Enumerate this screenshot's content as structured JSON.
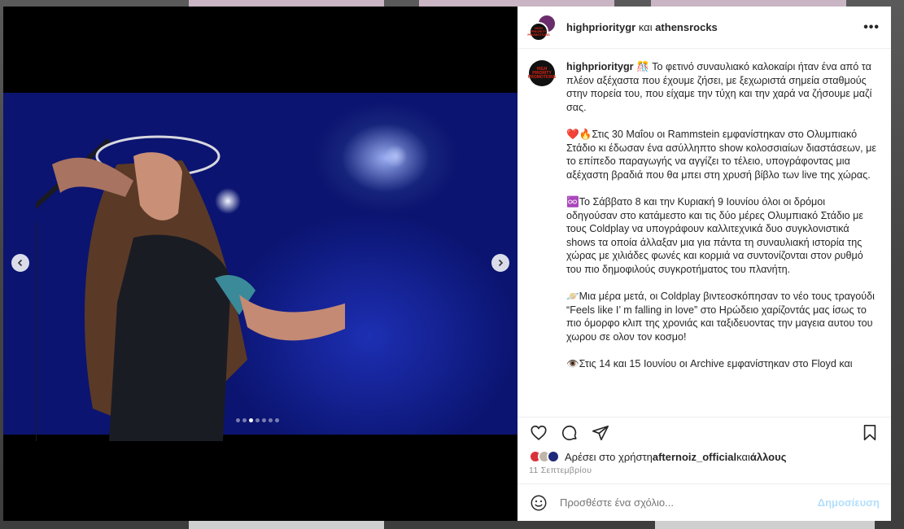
{
  "header": {
    "user1": "highprioritygr",
    "connector": " και ",
    "user2": "athensrocks"
  },
  "caption": {
    "username": "highprioritygr",
    "paragraphs": [
      "🎊 Το φετινό συναυλιακό καλοκαίρι ήταν ένα από τα πλέον αξέχαστα που έχουμε ζήσει, με ξεχωριστά σημεία σταθμούς στην πορεία του, που είχαμε την τύχη και την χαρά να ζήσουμε μαζί σας.",
      "❤️🔥Στις 30 Μαΐου οι Rammstein εμφανίστηκαν στο Ολυμπιακό Στάδιο κι έδωσαν ένα ασύλληπτο show κολοσσιαίων διαστάσεων, με το επίπεδο παραγωγής να αγγίζει το τέλειο, υπογράφοντας μια αξέχαστη βραδιά που θα μπει στη χρυσή βίβλο των live της χώρας.",
      "♾️Το Σάββατο 8 και την Κυριακή 9 Ιουνίου όλοι οι δρόμοι οδηγούσαν στο κατάμεστο και τις δύο μέρες Ολυμπιακό Στάδιο με τους Coldplay να υπογράφουν καλλιτεχνικά δυο συγκλονιστικά shows τα οποία άλλαξαν μια για πάντα τη συναυλιακή ιστορία της χώρας με χιλιάδες φωνές και κορμιά να συντονίζονται στον ρυθμό του πιο δημοφιλούς συγκροτήματος του πλανήτη.",
      "🪐Μια μέρα μετά, οι Coldplay βιντεοσκόπησαν το νέο τους τραγούδι “Feels like I’ m falling in love” στο Ηρώδειο χαρίζοντάς μας ίσως το πιο όμορφο κλιπ της χρονιάς και ταξιδευοντας την μαγεια αυτου του χωρου σε ολον τον κοσμο!",
      "👁️Στις 14 και 15 Ιουνίου οι Archive εμφανίστηκαν στο Floyd και"
    ]
  },
  "likes": {
    "prefix": "Αρέσει στο χρήστη ",
    "user": "afternoiz_official",
    "middle": " και ",
    "others": "άλλους"
  },
  "date": "11 Σεπτεμβρίου",
  "comment": {
    "placeholder": "Προσθέστε ένα σχόλιο...",
    "post_label": "Δημοσίευση"
  },
  "carousel": {
    "total": 7,
    "active": 3
  },
  "avatar_text": "HIGH PRIORITY PROMOTIONS",
  "colors": {
    "brand_red": "#dd2211",
    "post_disabled": "#b2dffc",
    "stage_blue": "#152ab0"
  }
}
